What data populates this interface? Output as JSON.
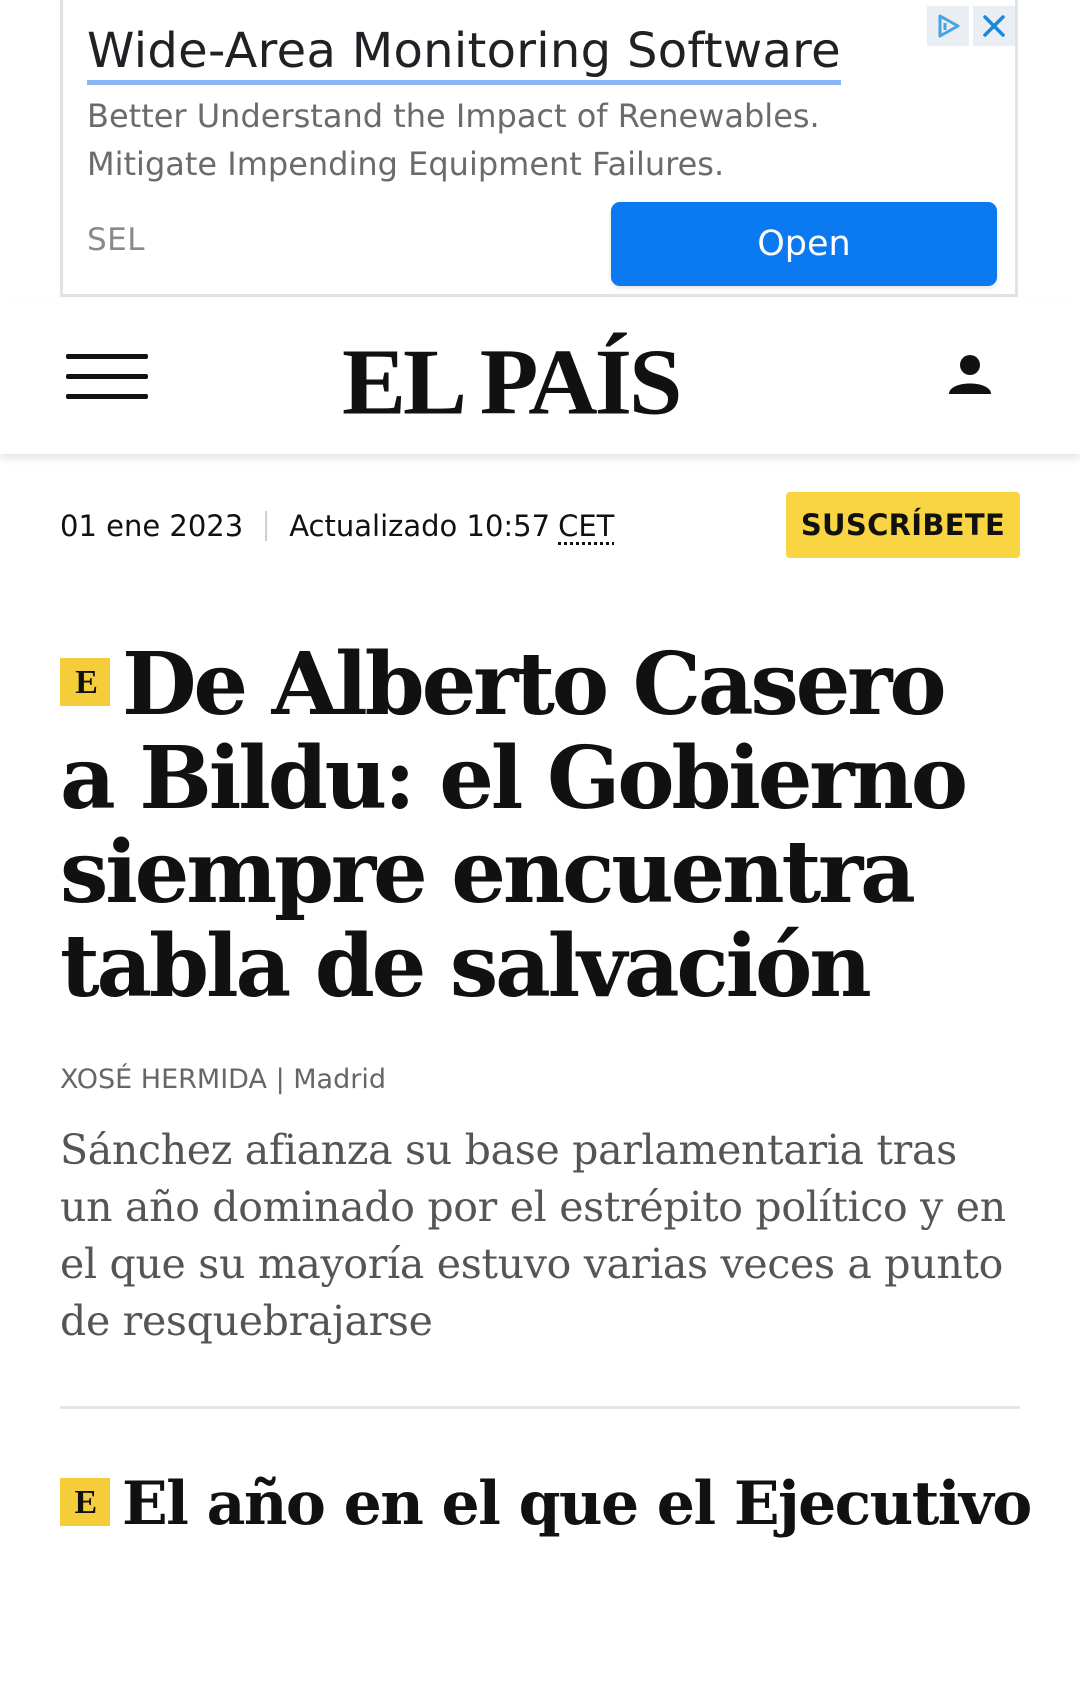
{
  "ad": {
    "title": "Wide-Area Monitoring Software",
    "description_lines": [
      "Better Understand the Impact of Renewables.",
      "Mitigate Impending Equipment Failures."
    ],
    "advertiser": "SEL",
    "cta_label": "Open",
    "icons": [
      "adchoices-icon",
      "close-icon"
    ],
    "colors": {
      "cta_bg": "#0b79f0",
      "title_underline": "#8ab4f8"
    }
  },
  "header": {
    "logo": "EL PAÍS",
    "icons": [
      "menu-icon",
      "user-icon"
    ]
  },
  "datebar": {
    "date": "01 ene 2023",
    "updated_label": "Actualizado 10:57",
    "timezone": "CET",
    "subscribe_label": "SUSCRÍBETE",
    "colors": {
      "subscribe_bg": "#f9d443"
    }
  },
  "article": {
    "badge": "E",
    "headline": "De Alberto Casero a Bildu: el Gobierno siempre encuentra tabla de salvación",
    "author": "XOSÉ HERMIDA",
    "byline_separator": " | ",
    "location": "Madrid",
    "summary": "Sánchez afianza su base parlamentaria tras un año dominado por el estrépito político y en el que su mayoría estuvo varias veces a punto de resquebrajarse"
  },
  "next_article": {
    "badge": "E",
    "headline": "El año en el que el Ejecutivo se"
  }
}
